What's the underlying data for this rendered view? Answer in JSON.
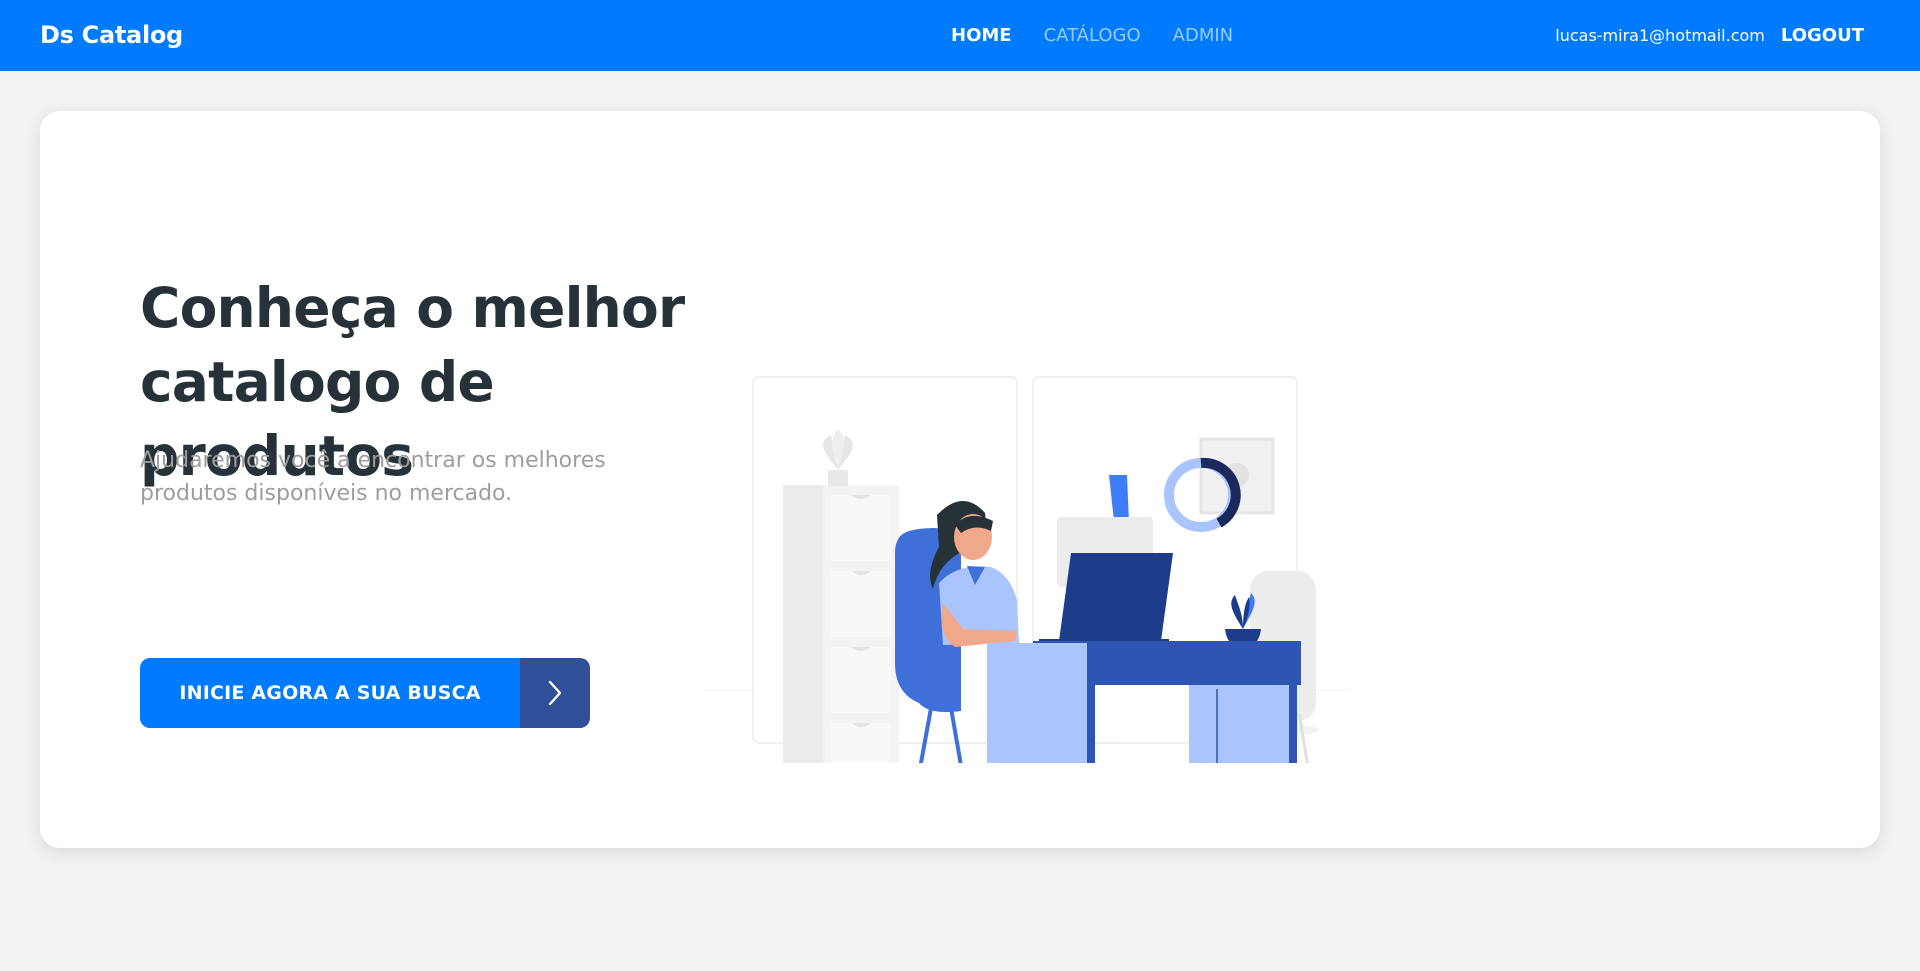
{
  "navbar": {
    "brand": "Ds Catalog",
    "links": [
      {
        "label": "HOME",
        "active": true
      },
      {
        "label": "CATÁLOGO",
        "active": false
      },
      {
        "label": "ADMIN",
        "active": false
      }
    ],
    "user_email": "lucas-mira1@hotmail.com",
    "logout_label": "LOGOUT"
  },
  "hero": {
    "title_line1": "Conheça o melhor",
    "title_line2": "catalogo de produtos",
    "subtitle_line1": "Ajudaremos você a encontrar os melhores",
    "subtitle_line2": "produtos disponíveis no mercado.",
    "cta_label": "INICIE AGORA A SUA BUSCA",
    "cta_icon": "chevron-right-icon"
  },
  "colors": {
    "primary": "#007bff",
    "primary_dark": "#2f4f99",
    "title": "#263238",
    "subtitle": "#9e9e9e",
    "background": "#f2f2f2"
  }
}
